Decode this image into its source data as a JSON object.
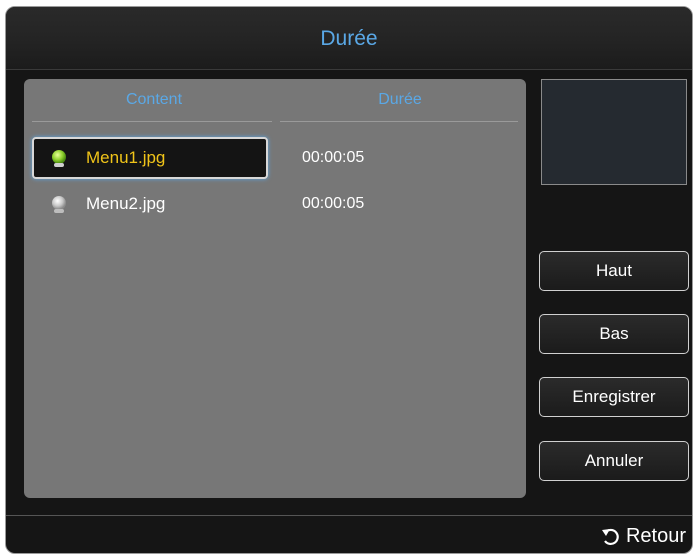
{
  "dialog": {
    "title": "Durée"
  },
  "table": {
    "headers": {
      "content": "Content",
      "duration": "Durée"
    },
    "rows": [
      {
        "name": "Menu1.jpg",
        "duration": "00:00:05",
        "selected": true,
        "icon": "green-bulb-icon"
      },
      {
        "name": "Menu2.jpg",
        "duration": "00:00:05",
        "selected": false,
        "icon": "gray-bulb-icon"
      }
    ]
  },
  "buttons": {
    "up": "Haut",
    "down": "Bas",
    "save": "Enregistrer",
    "cancel": "Annuler"
  },
  "footer": {
    "back_label": "Retour",
    "back_icon": "return-arrow-icon"
  },
  "colors": {
    "accent": "#5aa8e6",
    "selected_text": "#f0c419",
    "panel": "#777777",
    "background": "#151515"
  }
}
